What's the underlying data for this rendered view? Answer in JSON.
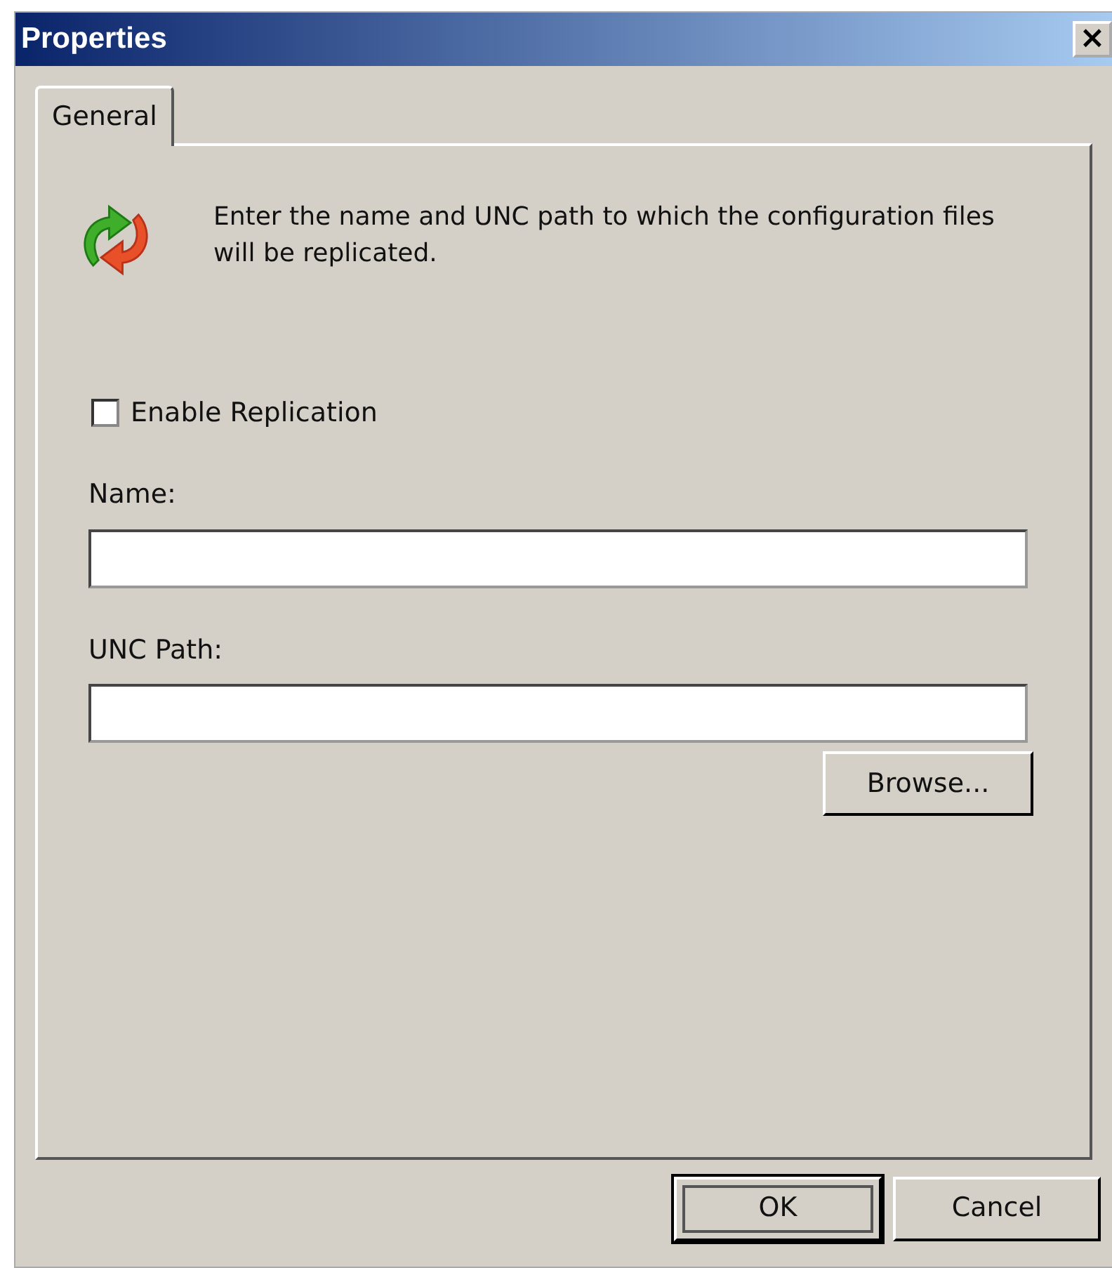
{
  "window": {
    "title": "Properties",
    "close": "×"
  },
  "tabs": [
    {
      "label": "General",
      "selected": true
    }
  ],
  "description": "Enter the name and UNC path to which the configuration files will be replicated.",
  "enable_replication": {
    "label": "Enable Replication",
    "checked": false
  },
  "fields": [
    {
      "label": "Name:"
    },
    {
      "label": "UNC Path:"
    }
  ],
  "browse_button": "Browse...",
  "buttons": [
    {
      "label": "OK",
      "focused": true
    },
    {
      "label": "Cancel",
      "focused": false
    }
  ]
}
